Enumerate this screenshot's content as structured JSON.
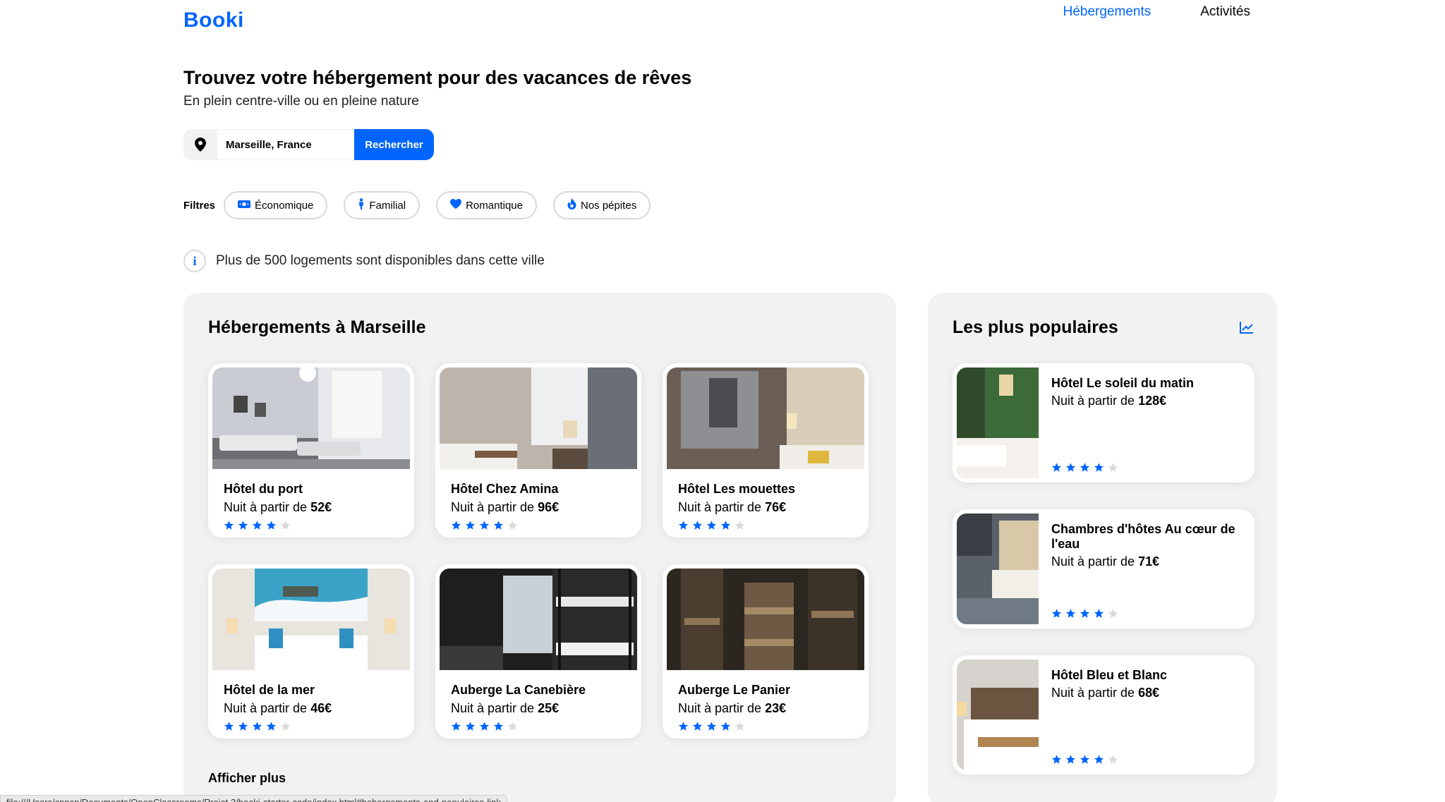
{
  "header": {
    "logo": "Booki",
    "nav": [
      {
        "label": "Hébergements",
        "active": true
      },
      {
        "label": "Activités",
        "active": false
      }
    ]
  },
  "hero": {
    "title": "Trouvez votre hébergement pour des vacances de rêves",
    "subtitle": "En plein centre-ville ou en pleine nature"
  },
  "search": {
    "value": "Marseille, France",
    "button_label": "Rechercher",
    "icon": "location-pin-icon"
  },
  "filters": {
    "label": "Filtres",
    "items": [
      {
        "label": "Économique",
        "icon": "money-icon"
      },
      {
        "label": "Familial",
        "icon": "person-icon"
      },
      {
        "label": "Romantique",
        "icon": "heart-icon"
      },
      {
        "label": "Nos pépites",
        "icon": "fire-icon"
      }
    ]
  },
  "info": {
    "text": "Plus de 500 logements sont disponibles dans cette ville",
    "icon": "info-icon"
  },
  "hebergements": {
    "title": "Hébergements à Marseille",
    "show_more": "Afficher plus",
    "items": [
      {
        "name": "Hôtel du port",
        "price_prefix": "Nuit à partir de ",
        "price": "52€",
        "rating": 4
      },
      {
        "name": "Hôtel Chez Amina",
        "price_prefix": "Nuit à partir de ",
        "price": "96€",
        "rating": 4
      },
      {
        "name": "Hôtel Les mouettes",
        "price_prefix": "Nuit à partir de ",
        "price": "76€",
        "rating": 4
      },
      {
        "name": "Hôtel de la mer",
        "price_prefix": "Nuit à partir de ",
        "price": "46€",
        "rating": 4
      },
      {
        "name": "Auberge La Canebière",
        "price_prefix": "Nuit à partir de ",
        "price": "25€",
        "rating": 4
      },
      {
        "name": "Auberge Le Panier",
        "price_prefix": "Nuit à partir de ",
        "price": "23€",
        "rating": 4
      }
    ]
  },
  "populaires": {
    "title": "Les plus populaires",
    "icon": "trending-chart-icon",
    "items": [
      {
        "name": "Hôtel Le soleil du matin",
        "price_prefix": "Nuit à partir de ",
        "price": "128€",
        "rating": 4
      },
      {
        "name": "Chambres d'hôtes Au cœur de l'eau",
        "price_prefix": "Nuit à partir de ",
        "price": "71€",
        "rating": 4
      },
      {
        "name": "Hôtel Bleu et Blanc",
        "price_prefix": "Nuit à partir de ",
        "price": "68€",
        "rating": 4
      }
    ]
  },
  "status_bar": {
    "url": "file:///Users/cpnsn/Documents/OpenClassrooms/Projet 2/booki-starter-code/index.html#hebergements-and-populaires-link"
  },
  "colors": {
    "accent": "#0065FC",
    "panel_bg": "#F2F2F2",
    "star_off": "#D9D9D9"
  }
}
